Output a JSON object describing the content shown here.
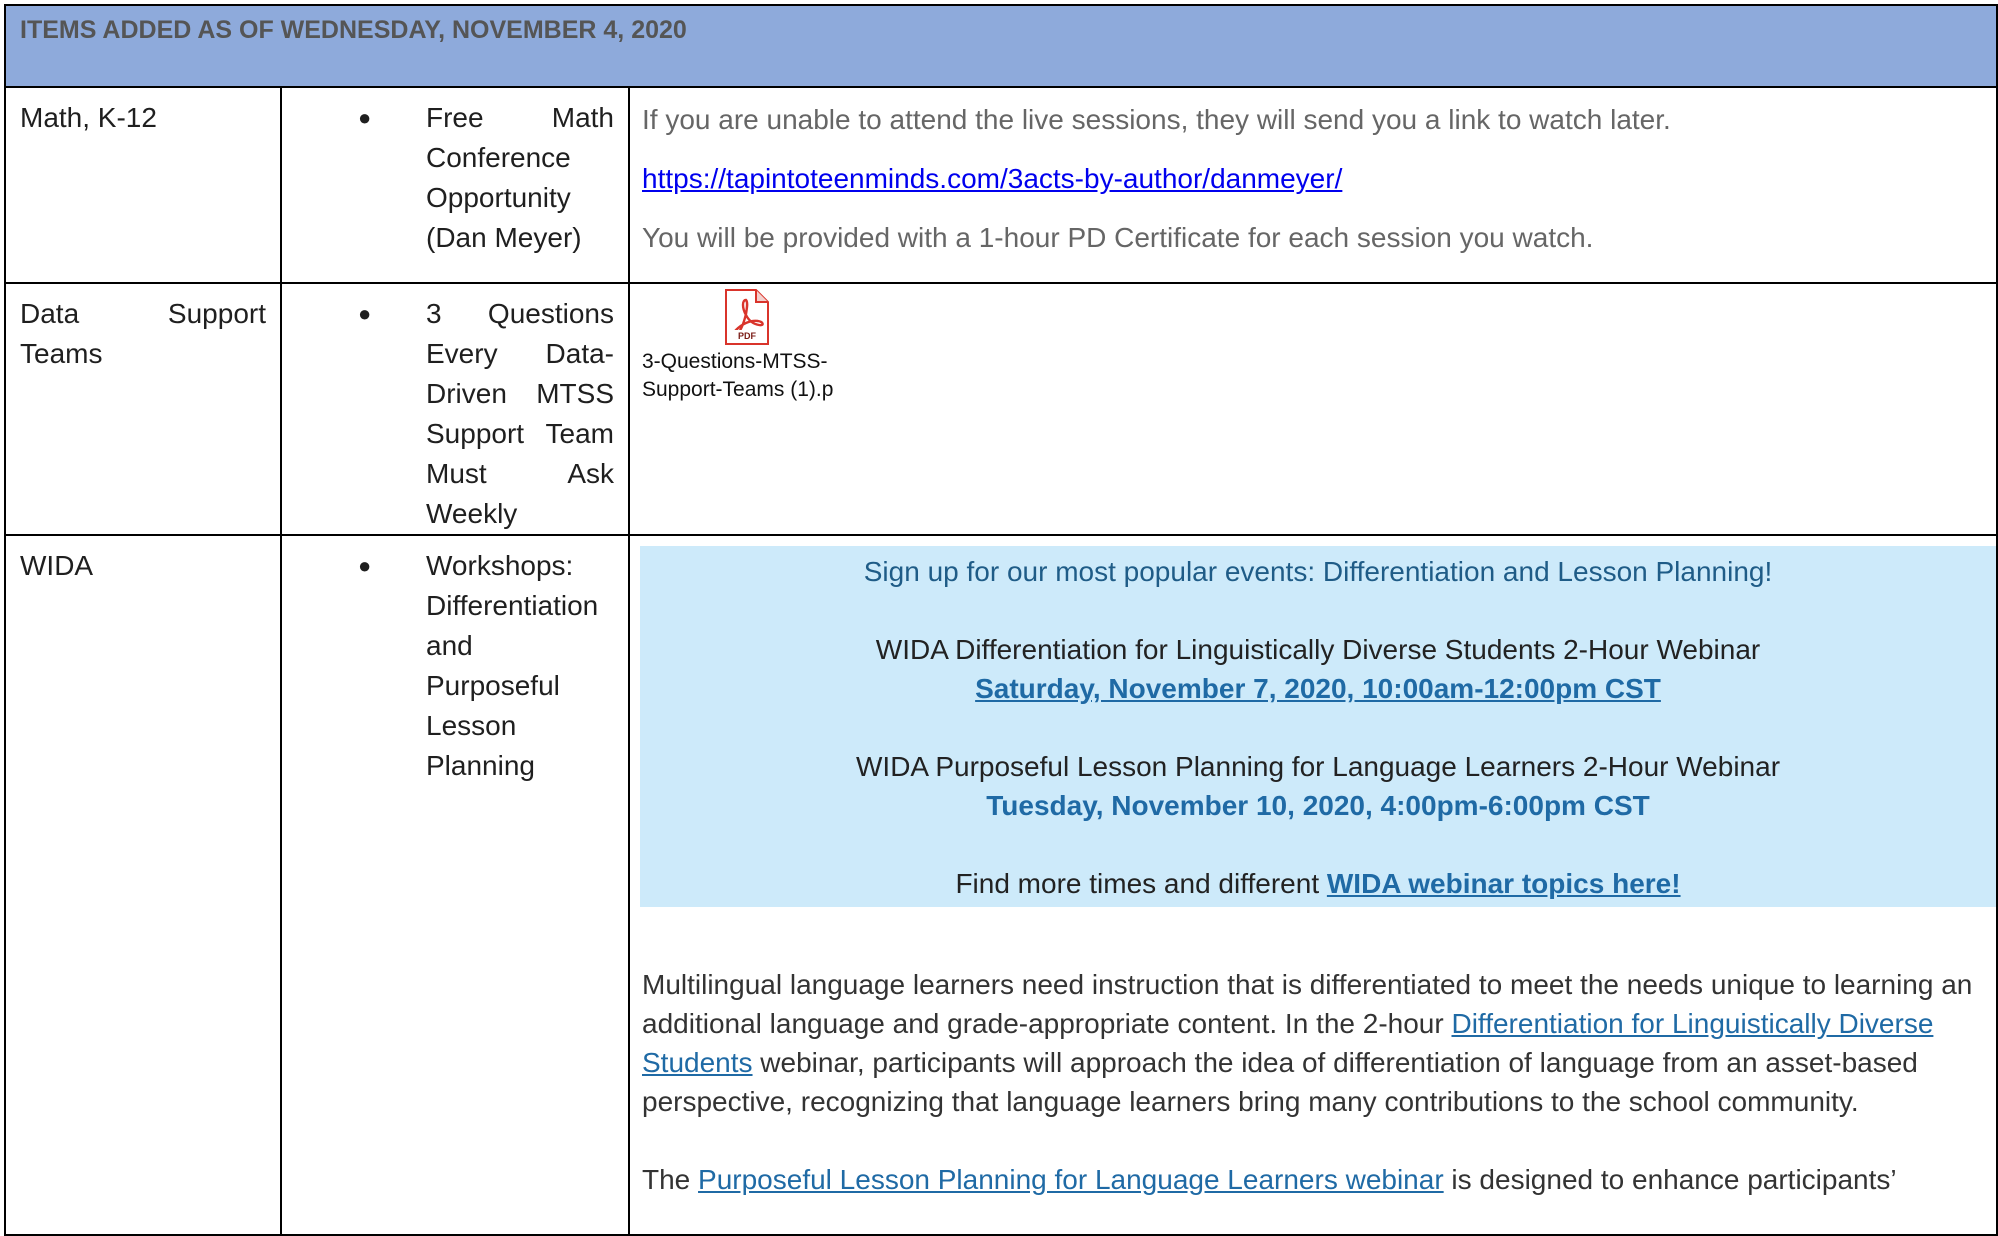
{
  "header": {
    "title": "ITEMS ADDED AS OF WEDNESDAY, NOVEMBER 4, 2020"
  },
  "rows": [
    {
      "category": "Math, K-12",
      "item": "Free Math Conference Opportunity (Dan Meyer)",
      "details": {
        "line1": "If you are unable to attend the live sessions, they will send you a link to watch later.",
        "link": "https://tapintoteenminds.com/3acts-by-author/danmeyer/",
        "line2": "You will be provided with a 1-hour PD Certificate for each session you watch."
      }
    },
    {
      "category": "Data Support Teams",
      "item": "3 Questions Every Data-Driven MTSS Support Team Must Ask Weekly",
      "attachment": {
        "icon": "pdf-icon",
        "icon_label": "PDF",
        "filename_line1": "3-Questions-MTSS-",
        "filename_line2": "Support-Teams (1).p"
      }
    },
    {
      "category": "WIDA",
      "item": "Workshops: Differentiation and Purposeful Lesson Planning",
      "event_box": {
        "headline": "Sign up for our most popular events: Differentiation and Lesson Planning!",
        "webinar1_title": "WIDA Differentiation for Linguistically Diverse Students 2-Hour Webinar",
        "webinar1_date": "Saturday, November 7, 2020, 10:00am-12:00pm CST",
        "webinar2_title": "WIDA Purposeful Lesson Planning for Language Learners 2-Hour Webinar",
        "webinar2_date": "Tuesday, November 10, 2020, 4:00pm-6:00pm CST",
        "more_prefix": "Find more times and different ",
        "more_link": "WIDA webinar topics here!"
      },
      "paragraph1": {
        "before": "Multilingual language learners need instruction that is differentiated to meet the needs unique to learning an additional language and grade-appropriate content. In the 2-hour ",
        "link": "Differentiation for Linguistically Diverse Students",
        "after": " webinar, participants will approach the idea of differentiation of language from an asset-based perspective, recognizing that language learners bring many contributions to the school community."
      },
      "paragraph2": {
        "before": "The ",
        "link": "Purposeful Lesson Planning for Language Learners webinar",
        "after": " is designed to enhance participants’"
      }
    }
  ],
  "colors": {
    "header_bg": "#8eaadb",
    "event_box_bg": "#cdeafa",
    "link_blue": "#0000ee",
    "wida_blue": "#1f6aa5"
  }
}
